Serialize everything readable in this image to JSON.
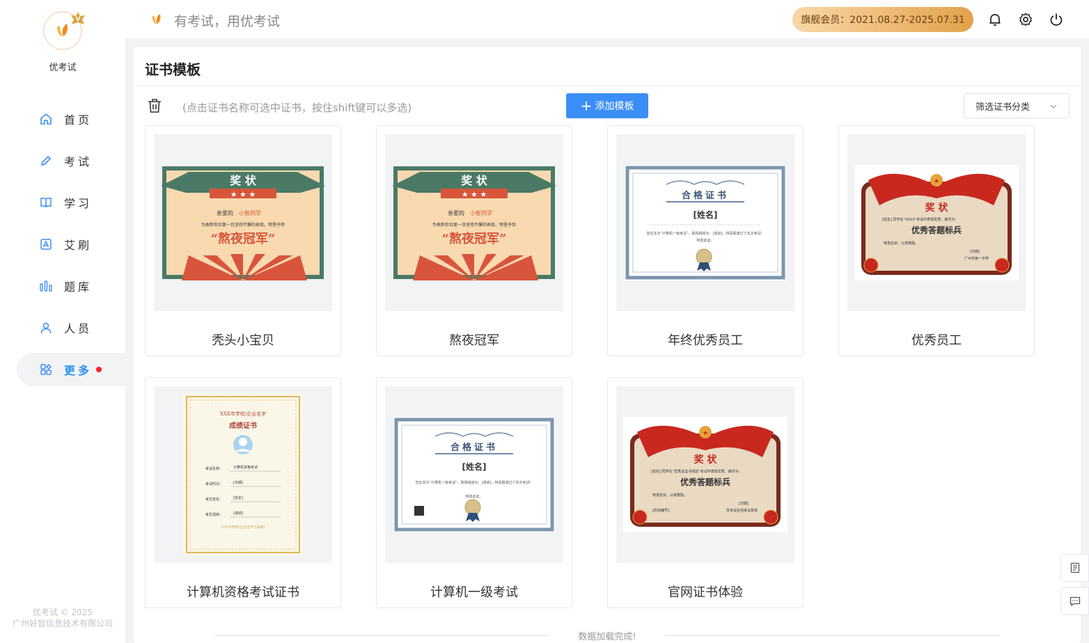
{
  "sidebar": {
    "brand": "优考试",
    "items": [
      {
        "label": "首页",
        "icon": "home-icon"
      },
      {
        "label": "考试",
        "icon": "pencil-icon"
      },
      {
        "label": "学习",
        "icon": "book-icon"
      },
      {
        "label": "艾刷",
        "icon": "letter-a-icon"
      },
      {
        "label": "题库",
        "icon": "bars-icon"
      },
      {
        "label": "人员",
        "icon": "user-icon"
      },
      {
        "label": "更多",
        "icon": "apps-icon"
      }
    ],
    "footer_line1": "优考试 © 2025",
    "footer_line2": "广州好智信息技术有限公司"
  },
  "topbar": {
    "slogan": "有考试，用优考试",
    "vip_text": "旗舰会员：2021.08.27-2025.07.31"
  },
  "panel": {
    "title": "证书模板",
    "hint": "(点击证书名称可选中证书，按住shift键可以多选)",
    "add_button": "添加模板",
    "filter_placeholder": "筛选证书分类",
    "loaded_text": "数据加载完成!"
  },
  "certificates": [
    {
      "name": "秃头小宝贝"
    },
    {
      "name": "熬夜冠军"
    },
    {
      "name": "年终优秀员工"
    },
    {
      "name": "优秀员工"
    },
    {
      "name": "计算机资格考试证书"
    },
    {
      "name": "计算机一级考试"
    },
    {
      "name": "官网证书体验"
    }
  ],
  "thumbs": {
    "award_title": "奖 状",
    "award_dear": "亲爱的",
    "award_name": "小智同学",
    "award_body": "为表彰你日复一日坚持不懈的表现，特授予你",
    "award_main": "“熬夜冠军”",
    "pass_title": "合格证书",
    "pass_name": "[姓名]",
    "pass_body": "您在本次“计算机一级考试”，取得成绩为：[成绩]，特喜报通过了本次考试！",
    "pass_issue": "特发此证。",
    "red_title": "奖 状",
    "red_main": "优秀答题标兵",
    "red_body": "[姓名] 同学在“XXXX”考试中表现优秀，被评为：",
    "red_footer": "特发此状，以资鼓励。",
    "red_date": "[日期]",
    "red_org": "广州市第一中学",
    "red_body2": "[姓名] 同学在“优秀试证书体验”考试中表现优秀，被评为：",
    "red_org2": "优考试在线考试系统",
    "red_code": "[防伪编号]",
    "score_org": "XXX市学校/企业名字",
    "score_title": "成绩证书",
    "score_f1": "考试名称：",
    "score_v1": "计算机资格考试",
    "score_f2": "考试时间：",
    "score_v2": "[日期]",
    "score_f3": "考生姓名：",
    "score_v3": "[姓名]",
    "score_f4": "考生成绩：",
    "score_v4": "[成绩]",
    "score_foot": "XXX市学校(企业名字)(盖章)"
  },
  "colors": {
    "accent": "#3a8ef6",
    "active_nav": "#2a8ef8",
    "dot": "#f5222d"
  }
}
